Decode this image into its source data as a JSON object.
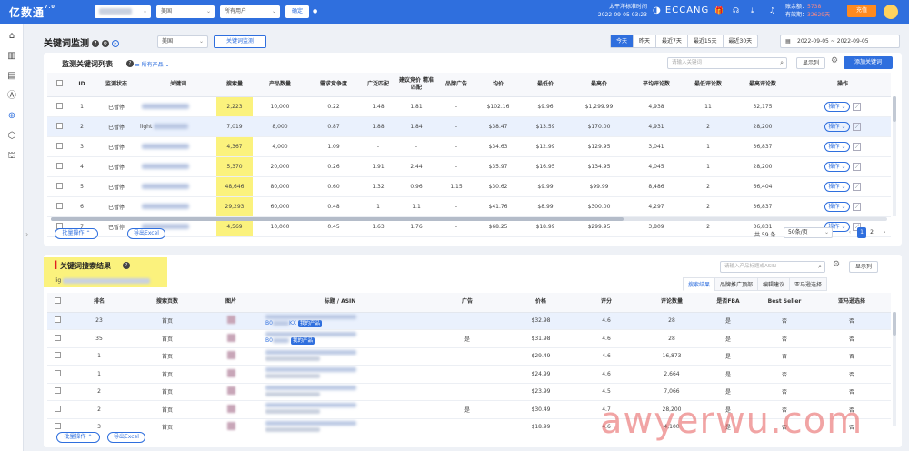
{
  "app": {
    "logo_text": "亿数通",
    "logo_sup": "7.0"
  },
  "topbar": {
    "site_select": "美国",
    "user_select": "所有用户",
    "confirm_btn": "确定",
    "timezone_label": "太平洋标准时间",
    "datetime": "2022-09-05 03:23",
    "brand": "ECCANG",
    "balance_label": "账余额：",
    "balance_value": "5738",
    "validity_label": "有效期：",
    "validity_value": "32629天",
    "recharge_btn": "充值"
  },
  "header": {
    "title": "关键词监测",
    "site_select": "美国",
    "monitor_btn": "关键词监测",
    "date_tabs": [
      "今天",
      "昨天",
      "最近7天",
      "最近15天",
      "最近30天"
    ],
    "active_tab": 0,
    "date_start": "2022-09-05",
    "date_sep": "~",
    "date_end": "2022-09-05"
  },
  "kw_list": {
    "title": "监测关键词列表",
    "products_label": "所有产品",
    "search_placeholder": "请输入关键词",
    "display_cols_btn": "显示列",
    "add_btn": "添加关键词",
    "columns": [
      "ID",
      "监测状态",
      "关键词",
      "搜索量",
      "产品数量",
      "需求竞争度",
      "广泛匹配",
      "建议竞价 精准匹配",
      "品牌广告",
      "均价",
      "最低价",
      "最高价",
      "平均评论数",
      "最低评论数",
      "最高评论数",
      "操作"
    ],
    "rows": [
      [
        "1",
        "已暂停",
        "",
        "2,223",
        "10,000",
        "0.22",
        "1.48",
        "1.81",
        "-",
        "$102.16",
        "$9.96",
        "$1,299.99",
        "4,938",
        "11",
        "32,175"
      ],
      [
        "2",
        "已暂停",
        "light",
        "7,019",
        "8,000",
        "0.87",
        "1.88",
        "1.84",
        "-",
        "$38.47",
        "$13.59",
        "$170.00",
        "4,931",
        "2",
        "28,200"
      ],
      [
        "3",
        "已暂停",
        "",
        "4,367",
        "4,000",
        "1.09",
        "-",
        "-",
        "-",
        "$34.63",
        "$12.99",
        "$129.95",
        "3,041",
        "1",
        "36,837"
      ],
      [
        "4",
        "已暂停",
        "",
        "5,370",
        "20,000",
        "0.26",
        "1.91",
        "2.44",
        "-",
        "$35.97",
        "$16.95",
        "$134.95",
        "4,045",
        "1",
        "28,200"
      ],
      [
        "5",
        "已暂停",
        "",
        "48,646",
        "80,000",
        "0.60",
        "1.32",
        "0.96",
        "1.15",
        "$30.62",
        "$9.99",
        "$99.99",
        "8,486",
        "2",
        "66,404"
      ],
      [
        "6",
        "已暂停",
        "",
        "29,293",
        "60,000",
        "0.48",
        "1",
        "1.1",
        "-",
        "$41.76",
        "$8.99",
        "$300.00",
        "4,297",
        "2",
        "36,837"
      ],
      [
        "7",
        "已暂停",
        "",
        "4,569",
        "10,000",
        "0.45",
        "1.63",
        "1.76",
        "-",
        "$68.25",
        "$18.99",
        "$299.95",
        "3,809",
        "2",
        "36,831"
      ]
    ],
    "op_btn": "操作",
    "bulk_btn": "批量操作",
    "export_btn": "导出Excel",
    "total_label": "共 59 条",
    "per_page": "50条/页",
    "pages": [
      "1",
      "2"
    ],
    "prev": "‹",
    "next": "›"
  },
  "kw_result": {
    "title": "关键词搜索结果",
    "keyword_prefix": "lig",
    "search_placeholder": "请输入产品标题或ASIN",
    "display_cols_btn": "显示列",
    "tabs": [
      "搜索结果",
      "品牌推广顶部",
      "编辑建议",
      "亚马逊选择"
    ],
    "active_tab": 0,
    "columns": [
      "排名",
      "搜索页数",
      "图片",
      "标题 / ASIN",
      "广告",
      "价格",
      "评分",
      "评论数量",
      "是否FBA",
      "Best Seller",
      "亚马逊选择",
      "操作"
    ],
    "rows": [
      [
        "23",
        "首页",
        "",
        "B0",
        "KX",
        "我的产品",
        "",
        "$32.98",
        "4.6",
        "28",
        "是",
        "否",
        "否"
      ],
      [
        "35",
        "首页",
        "",
        "B0",
        "",
        "我的产品",
        "是",
        "$31.98",
        "4.6",
        "28",
        "是",
        "否",
        "否"
      ],
      [
        "1",
        "首页",
        "",
        "",
        "",
        "",
        "",
        "$29.49",
        "4.6",
        "16,873",
        "是",
        "否",
        "否"
      ],
      [
        "1",
        "首页",
        "",
        "",
        "",
        "",
        "",
        "$24.99",
        "4.6",
        "2,664",
        "是",
        "否",
        "否"
      ],
      [
        "2",
        "首页",
        "",
        "",
        "",
        "",
        "",
        "$23.99",
        "4.5",
        "7,066",
        "是",
        "否",
        "否"
      ],
      [
        "2",
        "首页",
        "",
        "",
        "",
        "",
        "是",
        "$30.49",
        "4.7",
        "28,200",
        "是",
        "否",
        "否"
      ],
      [
        "3",
        "首页",
        "",
        "",
        "",
        "",
        "",
        "$18.99",
        "4.6",
        "4,100",
        "是",
        "否",
        "否"
      ]
    ],
    "op_btn": "操作",
    "bulk_btn": "批量操作",
    "export_btn": "导出Excel"
  },
  "watermark": "awyerwu.com",
  "colors": {
    "primary": "#2f6fde",
    "highlight": "#fbf27d",
    "status_red": "#e02020",
    "recharge": "#ff8a1f"
  }
}
